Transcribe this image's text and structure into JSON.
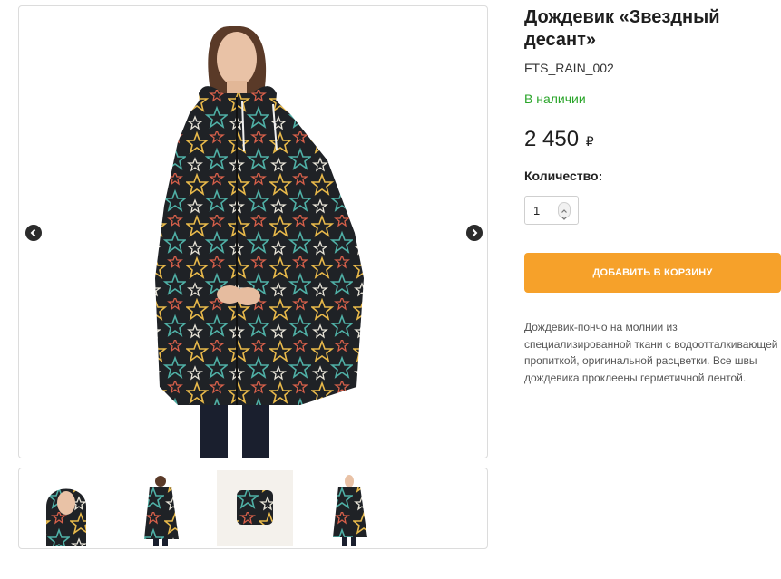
{
  "product": {
    "title": "Дождевик «Звездный десант»",
    "sku": "FTS_RAIN_002",
    "stock_status": "В наличии",
    "price_value": "2 450",
    "currency": "₽",
    "quantity_label": "Количество:",
    "quantity_value": "1",
    "add_to_cart_label": "Добавить в корзину",
    "description": "Дождевик-пончо на молнии из специализированной ткани с водоотталкивающей пропиткой, оригинальной расцветки. Все швы дождевика проклеены герметичной лентой."
  },
  "gallery": {
    "thumbnails": [
      "thumb-front-hood",
      "thumb-back",
      "thumb-folded-pouch",
      "thumb-front-full"
    ]
  },
  "colors": {
    "accent_button": "#f6a12a",
    "in_stock": "#2aa52a",
    "poncho_base": "#1f2226"
  }
}
